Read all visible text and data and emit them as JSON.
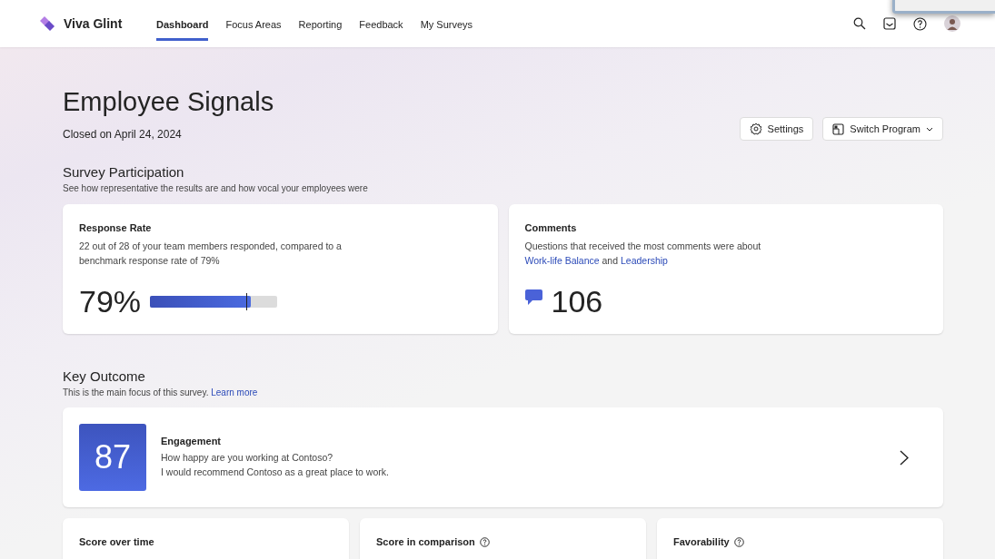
{
  "app": {
    "name": "Viva Glint"
  },
  "nav_tabs": [
    {
      "label": "Dashboard",
      "selected": true
    },
    {
      "label": "Focus Areas",
      "selected": false
    },
    {
      "label": "Reporting",
      "selected": false
    },
    {
      "label": "Feedback",
      "selected": false
    },
    {
      "label": "My Surveys",
      "selected": false
    }
  ],
  "page": {
    "title": "Employee Signals",
    "subtitle": "Closed on April 24, 2024"
  },
  "actions": [
    {
      "kind": "settings",
      "label": "Settings"
    },
    {
      "kind": "switch",
      "label": "Switch Program"
    }
  ],
  "participation": {
    "title": "Survey Participation",
    "description": "See how representative the results are and how vocal your employees were",
    "response_rate": {
      "title": "Response Rate",
      "description": "22 out of 28 of your team members responded, compared to a benchmark response rate of 79%",
      "value": "79%",
      "level": 0.79
    },
    "comments": {
      "title": "Comments",
      "description": [
        {
          "kind": "text",
          "text": "Questions that received the most comments were about "
        },
        {
          "kind": "link",
          "text": "Work-life Balance"
        },
        {
          "kind": "text",
          "text": " and "
        },
        {
          "kind": "link",
          "text": "Leadership"
        }
      ],
      "count": "106"
    }
  },
  "key_outcome": {
    "title": "Key Outcome",
    "description": "This is the main focus of this survey.",
    "link": "Learn more",
    "score": "87",
    "name": "Engagement",
    "questions": [
      "How happy are you working at Contoso?",
      "I would recommend Contoso as a great place to work."
    ]
  },
  "bottom_cards": [
    {
      "title": "Score over time",
      "help": false
    },
    {
      "title": "Score in comparison",
      "help": true
    },
    {
      "title": "Favorability",
      "help": true
    }
  ]
}
